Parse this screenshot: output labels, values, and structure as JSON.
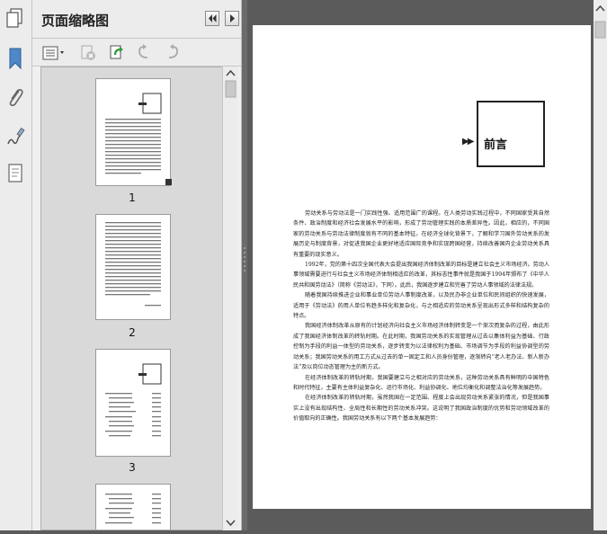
{
  "panel": {
    "title": "页面缩略图"
  },
  "thumbnails": [
    {
      "label": "1"
    },
    {
      "label": "2"
    },
    {
      "label": "3"
    }
  ],
  "document": {
    "heading": "前言",
    "heading_marker": "▶▶",
    "paragraphs": [
      "劳动关系与劳动法是一门实践性强、适用范围广的课程。在人类劳动实践过程中，不同国家受其自然条件、政治制度和经济社会发展水平的影响，形成了劳动管理实践的本质差异性。因此，相应的，不同国家的劳动关系与劳动法律制度就有不同的基本特征。在经济全球化背景下，了解和学习国外劳动关系的发展历史与制度背景，对促进我国企业更好地适应国际竞争和实现跨国经营，持续改善国内企业劳动关系具有重要的现实意义。",
      "1992年，党的第十四次全国代表大会提出我国经济体制改革的目标是建立社会主义市场经济。劳动人事领域需要进行与社会主义市场经济体制相适应的改革，其标志性事件就是我国于1994年颁布了《中华人民共和国劳动法》（简称《劳动法》，下同）。此后，我国逐步建立和完善了劳动人事领域的法律法规。",
      "随着我国持续推进企业和事业单位劳动人事制度改革，以及民办非企业单位和民间组织的快速发展，适用于《劳动法》的用人单位有趋多样化和复杂化，与之相适应的劳动关系呈现出形式多样和结构复杂的特点。",
      "我国经济体制改革从原有的计划经济向社会主义市场经济体制转变是一个渐次而复杂的过程，由此形成了我国经济体制改革的转轨时期。在此时期，我国劳动关系的实现管理从过去以集体利益为基础、行政控制为手段的利益一体型的劳动关系，逐步转变为以法律权利为基础、市场调节为手段的利益协调型的劳动关系；我国劳动关系的用工方式从过去的单一固定工和人员身份管理，逐渐转向“老人老办法、新人新办法”及以岗位动态管理为主的新方式。",
      "在经济体制改革的转轨时期，我国要建立与之相对应的劳动关系，这种劳动关系具有鲜明的中国特色和时代特征，主要有主体利益复杂化、运行市场化、利益协调化、地位均衡化和调整法治化等发展趋势。",
      "在经济体制改革的转轨时期，虽然我国在一定范围、程度上会出现劳动关系紧张的情况，但是我国事实上没有出现结构性、全局性和长期性的劳动关系冲突。这说明了我国政治制度的优势和劳动领域改革的价值取向的正确性。我国劳动关系有以下两个基本发展趋势："
    ]
  },
  "colors": {
    "panel_bg": "#f0f0f0",
    "workspace_bg": "#5b5b5b",
    "page_bg": "#ffffff",
    "accent_blue": "#2e6fbd"
  }
}
